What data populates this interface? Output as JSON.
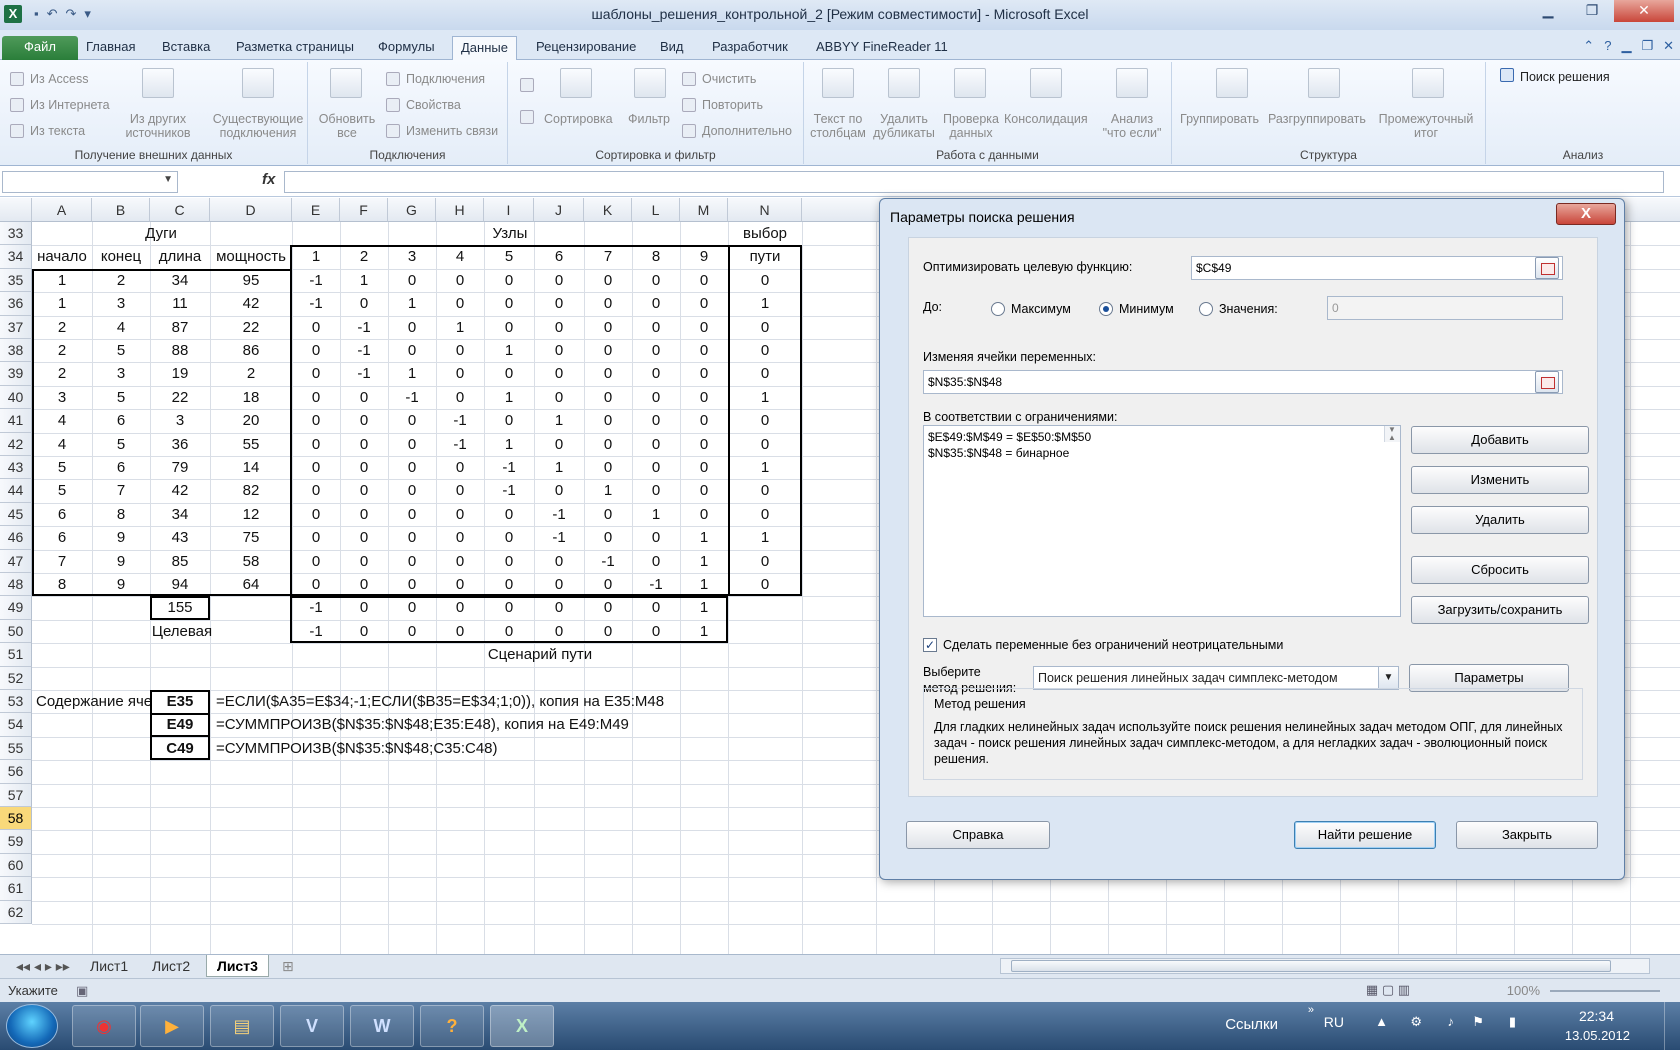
{
  "window": {
    "title": "шаблоны_решения_контрольной_2  [Режим совместимости]  -  Microsoft Excel"
  },
  "ribbon_tabs": [
    "Файл",
    "Главная",
    "Вставка",
    "Разметка страницы",
    "Формулы",
    "Данные",
    "Рецензирование",
    "Вид",
    "Разработчик",
    "ABBYY FineReader 11"
  ],
  "active_tab": "Данные",
  "ribbon": {
    "external": {
      "from_access": "Из Access",
      "from_web": "Из Интернета",
      "from_text": "Из текста",
      "other_l1": "Из других",
      "other_l2": "источников",
      "existing_l1": "Существующие",
      "existing_l2": "подключения",
      "label": "Получение внешних данных"
    },
    "connections": {
      "refresh_l1": "Обновить",
      "refresh_l2": "все",
      "conn": "Подключения",
      "props": "Свойства",
      "edit_links": "Изменить связи",
      "label": "Подключения"
    },
    "sort": {
      "sort": "Сортировка",
      "filter": "Фильтр",
      "clear": "Очистить",
      "reapply": "Повторить",
      "advanced": "Дополнительно",
      "label": "Сортировка и фильтр"
    },
    "data_tools": {
      "text_cols_l1": "Текст по",
      "text_cols_l2": "столбцам",
      "remove_dup_l1": "Удалить",
      "remove_dup_l2": "дубликаты",
      "validation_l1": "Проверка",
      "validation_l2": "данных",
      "consolidate": "Консолидация",
      "whatif_l1": "Анализ",
      "whatif_l2": "\"что если\"",
      "label": "Работа с данными"
    },
    "outline": {
      "group": "Группировать",
      "ungroup": "Разгруппировать",
      "subtotal_l1": "Промежуточный",
      "subtotal_l2": "итог",
      "label": "Структура"
    },
    "analysis": {
      "solver": "Поиск решения",
      "label": "Анализ"
    }
  },
  "formula_bar": {
    "fx": "fx"
  },
  "columns": [
    "A",
    "B",
    "C",
    "D",
    "E",
    "F",
    "G",
    "H",
    "I",
    "J",
    "K",
    "L",
    "M",
    "N"
  ],
  "row_numbers": [
    "33",
    "34",
    "35",
    "36",
    "37",
    "38",
    "39",
    "40",
    "41",
    "42",
    "43",
    "44",
    "45",
    "46",
    "47",
    "48",
    "49",
    "50",
    "51",
    "52",
    "53",
    "54",
    "55",
    "56",
    "57",
    "58",
    "59",
    "60",
    "61",
    "62"
  ],
  "selected_row": "58",
  "sheet": {
    "h_arcs": "Дуги",
    "h_nodes": "Узлы",
    "h_choice": "выбор",
    "sub_headers": [
      "начало",
      "конец",
      "длина",
      "мощность",
      "1",
      "2",
      "3",
      "4",
      "5",
      "6",
      "7",
      "8",
      "9",
      "пути"
    ],
    "rows": [
      [
        "1",
        "2",
        "34",
        "95",
        "-1",
        "1",
        "0",
        "0",
        "0",
        "0",
        "0",
        "0",
        "0",
        "0"
      ],
      [
        "1",
        "3",
        "11",
        "42",
        "-1",
        "0",
        "1",
        "0",
        "0",
        "0",
        "0",
        "0",
        "0",
        "1"
      ],
      [
        "2",
        "4",
        "87",
        "22",
        "0",
        "-1",
        "0",
        "1",
        "0",
        "0",
        "0",
        "0",
        "0",
        "0"
      ],
      [
        "2",
        "5",
        "88",
        "86",
        "0",
        "-1",
        "0",
        "0",
        "1",
        "0",
        "0",
        "0",
        "0",
        "0"
      ],
      [
        "2",
        "3",
        "19",
        "2",
        "0",
        "-1",
        "1",
        "0",
        "0",
        "0",
        "0",
        "0",
        "0",
        "0"
      ],
      [
        "3",
        "5",
        "22",
        "18",
        "0",
        "0",
        "-1",
        "0",
        "1",
        "0",
        "0",
        "0",
        "0",
        "1"
      ],
      [
        "4",
        "6",
        "3",
        "20",
        "0",
        "0",
        "0",
        "-1",
        "0",
        "1",
        "0",
        "0",
        "0",
        "0"
      ],
      [
        "4",
        "5",
        "36",
        "55",
        "0",
        "0",
        "0",
        "-1",
        "1",
        "0",
        "0",
        "0",
        "0",
        "0"
      ],
      [
        "5",
        "6",
        "79",
        "14",
        "0",
        "0",
        "0",
        "0",
        "-1",
        "1",
        "0",
        "0",
        "0",
        "1"
      ],
      [
        "5",
        "7",
        "42",
        "82",
        "0",
        "0",
        "0",
        "0",
        "-1",
        "0",
        "1",
        "0",
        "0",
        "0"
      ],
      [
        "6",
        "8",
        "34",
        "12",
        "0",
        "0",
        "0",
        "0",
        "0",
        "-1",
        "0",
        "1",
        "0",
        "0"
      ],
      [
        "6",
        "9",
        "43",
        "75",
        "0",
        "0",
        "0",
        "0",
        "0",
        "-1",
        "0",
        "0",
        "1",
        "1"
      ],
      [
        "7",
        "9",
        "85",
        "58",
        "0",
        "0",
        "0",
        "0",
        "0",
        "0",
        "-1",
        "0",
        "1",
        "0"
      ],
      [
        "8",
        "9",
        "94",
        "64",
        "0",
        "0",
        "0",
        "0",
        "0",
        "0",
        "0",
        "-1",
        "1",
        "0"
      ]
    ],
    "row49_c": "155",
    "row49_nodes": [
      "-1",
      "0",
      "0",
      "0",
      "0",
      "0",
      "0",
      "0",
      "1"
    ],
    "row50_label": "Целевая",
    "row50_nodes": [
      "-1",
      "0",
      "0",
      "0",
      "0",
      "0",
      "0",
      "0",
      "1"
    ],
    "scenario": "Сценарий пути",
    "content_label": "Содержание ячеек",
    "cellref_e35": "E35",
    "cellref_e49": "E49",
    "cellref_c49": "C49",
    "formula_e35": "=ЕСЛИ($A35=E$34;-1;ЕСЛИ($B35=E$34;1;0)), копия на E35:M48",
    "formula_e49": "=СУММПРОИЗВ($N$35:$N$48;E35:E48), копия на E49:M49",
    "formula_c49": "=СУММПРОИЗВ($N$35:$N$48;C35:C48)"
  },
  "sheet_tabs": [
    "Лист1",
    "Лист2",
    "Лист3"
  ],
  "active_sheet": "Лист3",
  "status": {
    "mode": "Укажите",
    "zoom": "100%"
  },
  "taskbar": {
    "links": "Ссылки",
    "lang": "RU",
    "time": "22:34",
    "date": "13.05.2012"
  },
  "dialog": {
    "title": "Параметры поиска решения",
    "close": "X",
    "objective_label": "Оптимизировать целевую функцию:",
    "objective_value": "$C$49",
    "to_label": "До:",
    "max": "Максимум",
    "min": "Минимум",
    "value_of": "Значения:",
    "value_of_input": "0",
    "selected_goal": "min",
    "changing_label": "Изменяя ячейки переменных:",
    "changing_value": "$N$35:$N$48",
    "constraints_label": "В соответствии с ограничениями:",
    "constraints": [
      "$E$49:$M$49 = $E$50:$M$50",
      "$N$35:$N$48 = бинарное"
    ],
    "btn_add": "Добавить",
    "btn_change": "Изменить",
    "btn_delete": "Удалить",
    "btn_reset": "Сбросить",
    "btn_load": "Загрузить/сохранить",
    "nonneg_label": "Сделать переменные без ограничений неотрицательными",
    "nonneg_checked": true,
    "method_label_1": "Выберите",
    "method_label_2": "метод решения:",
    "method_value": "Поиск решения линейных задач симплекс-методом",
    "btn_options": "Параметры",
    "method_box_title": "Метод решения",
    "method_desc": "Для гладких нелинейных задач используйте поиск решения нелинейных задач методом ОПГ, для линейных задач - поиск решения линейных задач симплекс-методом, а для негладких задач - эволюционный поиск решения.",
    "btn_help": "Справка",
    "btn_solve": "Найти решение",
    "btn_close": "Закрыть"
  }
}
